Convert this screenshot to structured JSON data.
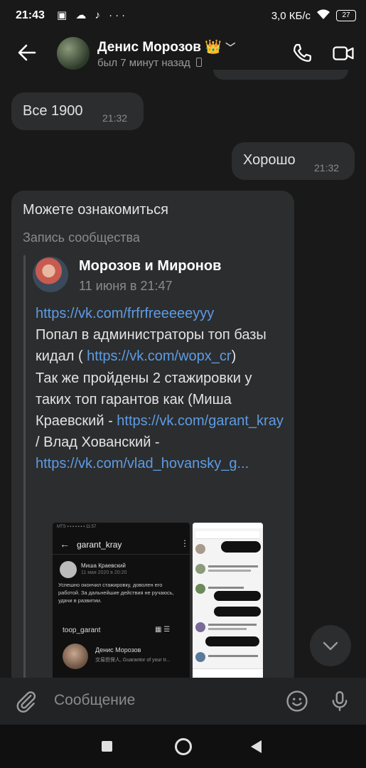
{
  "status_bar": {
    "time": "21:43",
    "speed": "3,0 КБ/с",
    "battery": "27"
  },
  "header": {
    "name": "Денис Морозов",
    "badge": "👑",
    "status": "был 7 минут назад"
  },
  "messages": [
    {
      "text": "Все 1900",
      "time": "21:32",
      "direction": "incoming"
    },
    {
      "text": "Хорошо",
      "time": "21:32",
      "direction": "outgoing"
    }
  ],
  "post": {
    "caption": "Можете ознакомиться",
    "kind": "Запись сообщества",
    "author": "Морозов и Миронов",
    "date": "11 июня в 21:47",
    "body": {
      "link1": "https://vk.com/frfrfreeeeeyyy",
      "text1": "Попал в администраторы топ базы кидал ( ",
      "link2": "https://vk.com/wopx_cr",
      "text2": ")",
      "text3": "Так же пройдены 2 стажировки у таких топ гарантов как (Миша Краевский - ",
      "link3": "https://vk.com/garant_kray",
      "text4": " / Влад Хованский - ",
      "link4": "https://vk.com/vlad_hovansky_g..."
    },
    "screenshot1": {
      "header": "garant_kray",
      "user": "Миша Краевский",
      "date": "11 мая 2020 в 20:20",
      "text": "Успешно окончил стажировку, доволен его работой. За дальнейшие действия не ручаюсь, удачи в развитии.",
      "section": "toop_garant",
      "name2": "Денис Морозов",
      "sub2": "交易担保人, Guarantor of your tr..."
    }
  },
  "composer": {
    "placeholder": "Сообщение"
  }
}
